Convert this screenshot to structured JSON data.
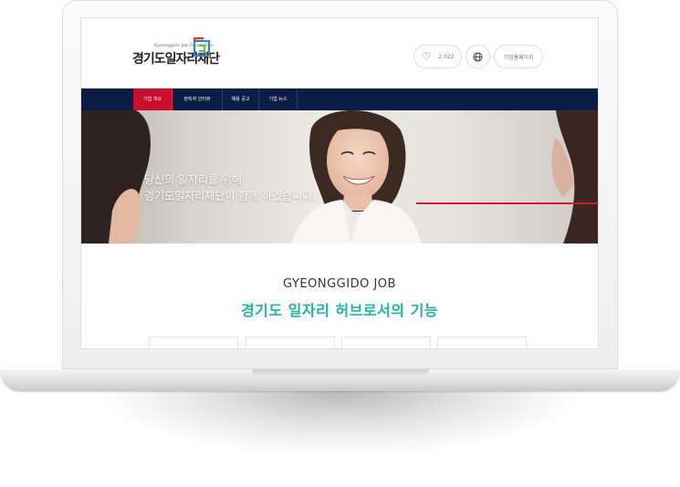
{
  "header": {
    "logo_sub": "Gyeonggido Job Foundation",
    "logo_main": "경기도일자리재단",
    "like_count": "2,022",
    "home_label": "기업홈페이지"
  },
  "nav": {
    "items": [
      {
        "label": "기업 개요"
      },
      {
        "label": "현직자 인터뷰"
      },
      {
        "label": "채용 공고"
      },
      {
        "label": "기업 뉴스"
      }
    ]
  },
  "hero": {
    "line1": "당신의 일자리를 위해",
    "line2": "경기도일자리재단이 함께 하겠습니다."
  },
  "section": {
    "title_en": "GYEONGGIDO JOB",
    "title_ko": "경기도 일자리 허브로서의 기능"
  },
  "colors": {
    "nav_bg": "#0b1c45",
    "nav_active": "#c8102e",
    "accent_teal": "#21b3a4",
    "hero_red_line": "#d01c2c"
  },
  "icons": [
    "heart-icon",
    "globe-icon",
    "logo-mark-icon"
  ]
}
